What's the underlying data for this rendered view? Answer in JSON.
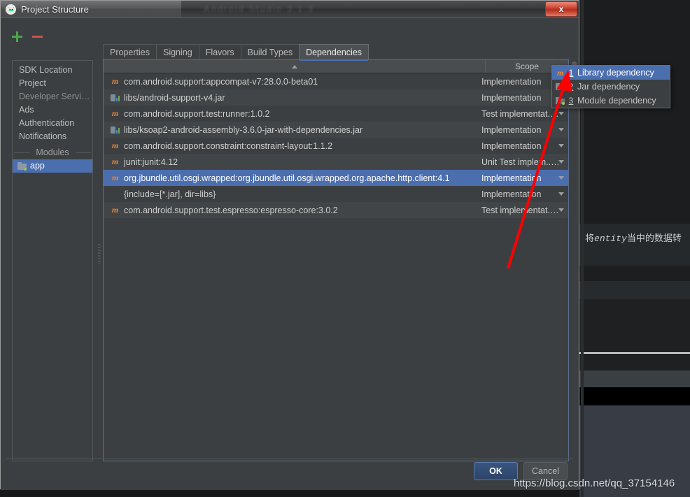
{
  "window": {
    "title": "Project Structure",
    "ghost_title": "Android Studio 3.1.3",
    "close_label": "x",
    "app_icon": "android-studio-icon"
  },
  "toolbar": {
    "add_label": "+",
    "remove_label": "−"
  },
  "sidebar": {
    "items": [
      {
        "label": "SDK Location",
        "selected": false,
        "dim": false
      },
      {
        "label": "Project",
        "selected": false,
        "dim": false
      },
      {
        "label": "Developer Servi…",
        "selected": false,
        "dim": true
      },
      {
        "label": "Ads",
        "selected": false,
        "dim": false
      },
      {
        "label": "Authentication",
        "selected": false,
        "dim": false
      },
      {
        "label": "Notifications",
        "selected": false,
        "dim": false
      }
    ],
    "group_label": "Modules",
    "modules": [
      {
        "label": "app",
        "selected": true,
        "icon": "module-folder-icon"
      }
    ]
  },
  "tabs": [
    {
      "label": "Properties",
      "active": false
    },
    {
      "label": "Signing",
      "active": false
    },
    {
      "label": "Flavors",
      "active": false
    },
    {
      "label": "Build Types",
      "active": false
    },
    {
      "label": "Dependencies",
      "active": true
    }
  ],
  "table": {
    "columns": [
      {
        "label": "",
        "sort": "asc"
      },
      {
        "label": "Scope"
      }
    ],
    "rows": [
      {
        "icon": "maven-icon",
        "name": "com.android.support:appcompat-v7:28.0.0-beta01",
        "scope": "Implementation",
        "has_caret": true,
        "selected": false
      },
      {
        "icon": "jar-icon",
        "name": "libs/android-support-v4.jar",
        "scope": "Implementation",
        "has_caret": true,
        "selected": false
      },
      {
        "icon": "maven-icon",
        "name": "com.android.support.test:runner:1.0.2",
        "scope": "Test implementat.…",
        "has_caret": true,
        "selected": false
      },
      {
        "icon": "jar-icon",
        "name": "libs/ksoap2-android-assembly-3.6.0-jar-with-dependencies.jar",
        "scope": "Implementation",
        "has_caret": true,
        "selected": false
      },
      {
        "icon": "maven-icon",
        "name": "com.android.support.constraint:constraint-layout:1.1.2",
        "scope": "Implementation",
        "has_caret": true,
        "selected": false
      },
      {
        "icon": "maven-icon",
        "name": "junit:junit:4.12",
        "scope": "Unit Test implem..…",
        "has_caret": true,
        "selected": false
      },
      {
        "icon": "maven-icon",
        "name": "org.jbundle.util.osgi.wrapped:org.jbundle.util.osgi.wrapped.org.apache.http.client:4.1",
        "scope": "Implementation",
        "has_caret": true,
        "selected": true
      },
      {
        "icon": "none",
        "name": "{include=[*.jar], dir=libs}",
        "scope": "Implementation",
        "has_caret": true,
        "selected": false
      },
      {
        "icon": "maven-icon",
        "name": "com.android.support.test.espresso:espresso-core:3.0.2",
        "scope": "Test implementat.…",
        "has_caret": true,
        "selected": false
      }
    ]
  },
  "dependency_menu": {
    "items": [
      {
        "mnemonic": "1",
        "label": "Library dependency",
        "icon": "maven-icon",
        "highlighted": true
      },
      {
        "mnemonic": "2",
        "label": "Jar dependency",
        "icon": "jar-folder-icon",
        "highlighted": false
      },
      {
        "mnemonic": "3",
        "label": "Module dependency",
        "icon": "module-icon",
        "highlighted": false
      }
    ]
  },
  "buttons": {
    "ok": "OK",
    "cancel": "Cancel"
  },
  "annotations": {
    "note_prefix": "将",
    "note_mono": "entity",
    "note_suffix": "当中的数据转",
    "watermark": "https://blog.csdn.net/qq_37154146",
    "arrow_color": "#ff0000"
  },
  "colors": {
    "dialog_bg": "#3c3f41",
    "selection_blue": "#4b6eaf",
    "accent_green": "#4ca64c",
    "accent_red": "#c75450",
    "maven_orange": "#e8873a",
    "desktop_bg": "#17181a"
  }
}
